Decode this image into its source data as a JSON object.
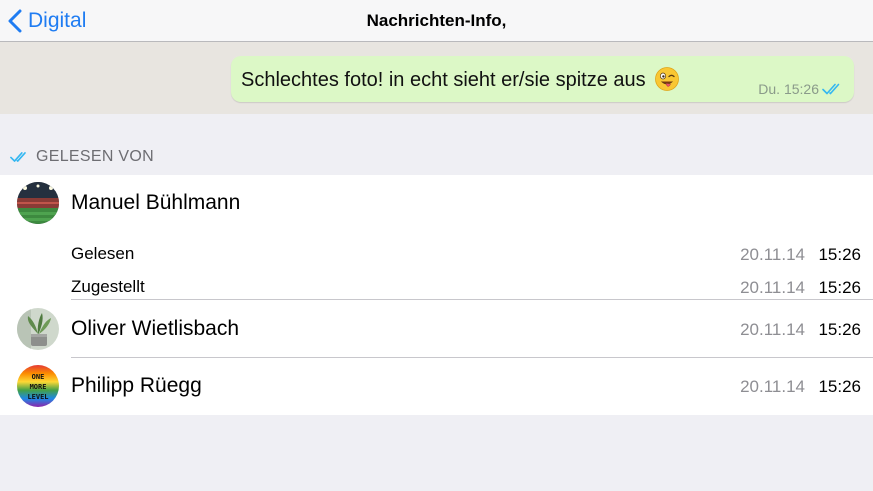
{
  "navbar": {
    "back_label": "Digital",
    "title": "Nachrichten-Info,"
  },
  "message": {
    "text": "Schlechtes foto! in echt sieht er/sie spitze aus",
    "emoji": "winking-face-with-tongue-emoji",
    "timestamp": "Du. 15:26",
    "status_icon": "double-check-icon"
  },
  "read_section": {
    "header": "GELESEN VON",
    "icon": "double-check-icon"
  },
  "recipients": [
    {
      "name": "Manuel Bühlmann",
      "details": [
        {
          "label": "Gelesen",
          "date": "20.11.14",
          "time": "15:26"
        },
        {
          "label": "Zugestellt",
          "date": "20.11.14",
          "time": "15:26"
        }
      ]
    },
    {
      "name": "Oliver Wietlisbach",
      "date": "20.11.14",
      "time": "15:26"
    },
    {
      "name": "Philipp Rüegg",
      "date": "20.11.14",
      "time": "15:26",
      "avatar_text": "ONE MORE LEVEL"
    }
  ],
  "colors": {
    "accent": "#1f7cf2",
    "bubble": "#dcf8c6",
    "chat_bg": "#e8e5e0",
    "page_bg": "#efeff4",
    "tick_blue": "#34b7f1"
  }
}
